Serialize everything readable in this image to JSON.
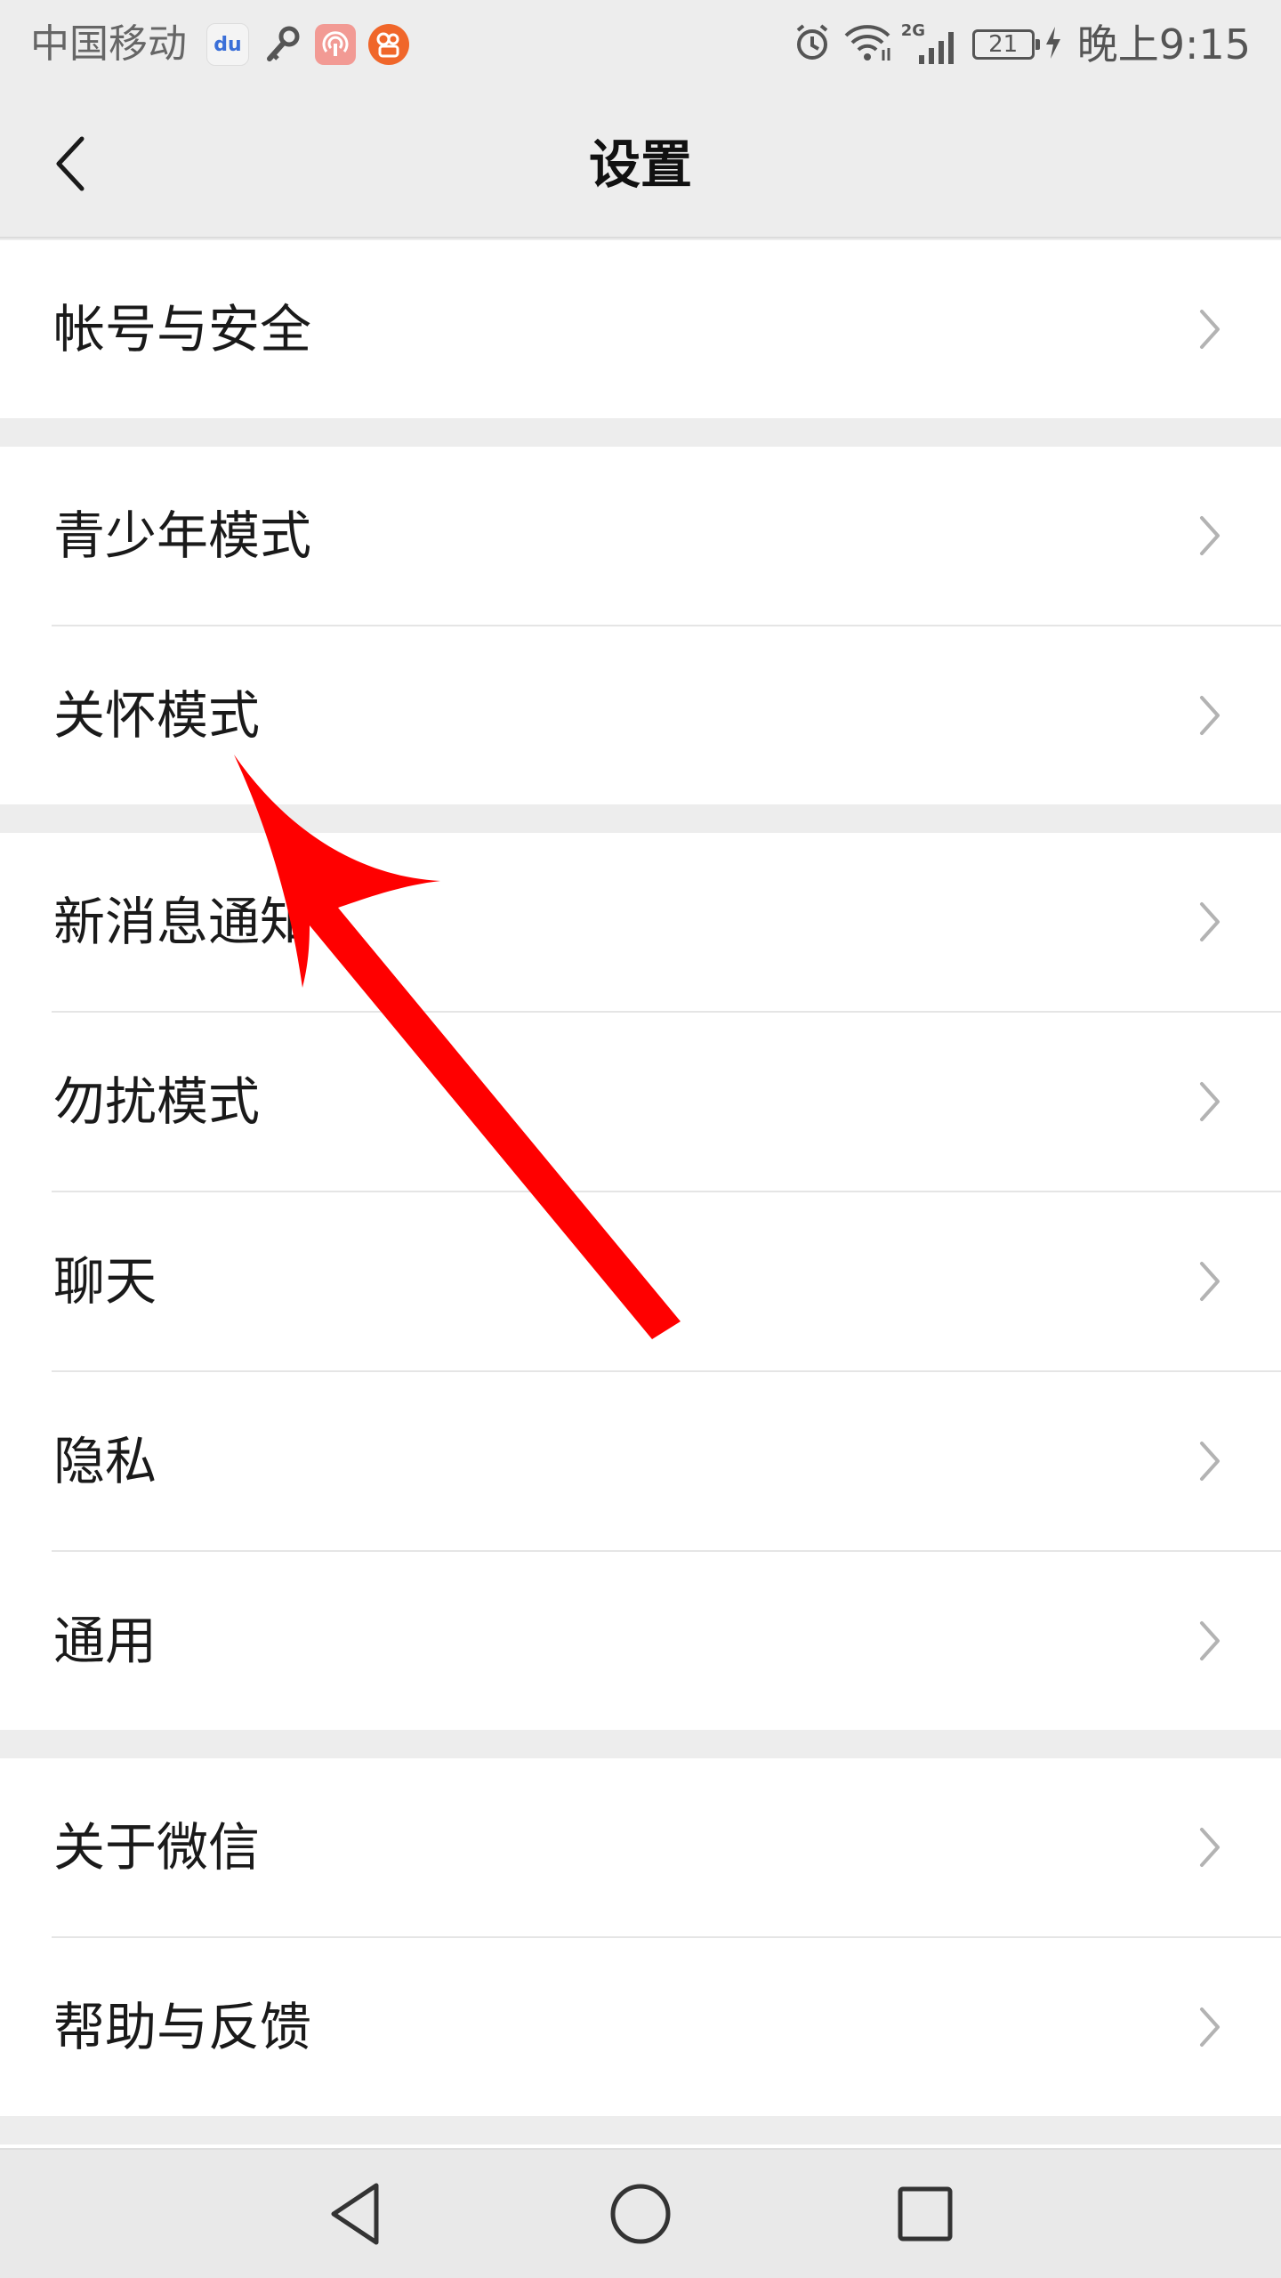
{
  "status_bar": {
    "carrier": "中国移动",
    "app_icons": [
      {
        "name": "baidu-icon",
        "glyph": "du"
      },
      {
        "name": "key-icon",
        "glyph": ""
      },
      {
        "name": "podcast-icon",
        "glyph": ""
      },
      {
        "name": "kuaishou-icon",
        "glyph": ""
      }
    ],
    "network": "2G",
    "battery_level": "21",
    "time": "晚上9:15"
  },
  "nav_bar": {
    "title": "设置",
    "back_icon": "chevron-left-icon"
  },
  "settings_groups": [
    {
      "items": [
        {
          "label": "帐号与安全"
        }
      ]
    },
    {
      "items": [
        {
          "label": "青少年模式"
        },
        {
          "label": "关怀模式"
        }
      ]
    },
    {
      "items": [
        {
          "label": "新消息通知"
        },
        {
          "label": "勿扰模式"
        },
        {
          "label": "聊天"
        },
        {
          "label": "隐私"
        },
        {
          "label": "通用"
        }
      ]
    },
    {
      "items": [
        {
          "label": "关于微信"
        },
        {
          "label": "帮助与反馈"
        }
      ]
    }
  ],
  "annotation": {
    "color": "#ff0000",
    "points_to": "关怀模式"
  },
  "system_nav": {
    "buttons": [
      "back-triangle-icon",
      "home-circle-icon",
      "recents-square-icon"
    ]
  },
  "colors": {
    "background": "#ededed",
    "row_background": "#ffffff",
    "text": "#1a1a1a",
    "chevron": "#b3b3b3",
    "divider": "#e5e5e5"
  }
}
